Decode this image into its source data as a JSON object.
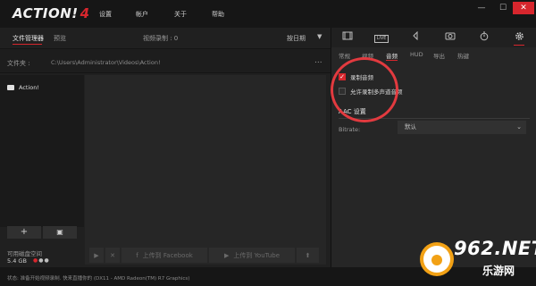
{
  "app": {
    "logo_word": "ACTION!",
    "logo_number": "4",
    "menu": [
      "设置",
      "帐户",
      "关于",
      "帮助"
    ],
    "window_buttons": {
      "minimize": "—",
      "maximize": "☐",
      "close": "✕"
    }
  },
  "file_manager": {
    "tab_file_manager": "文件管理器",
    "tab_preview": "预览",
    "video_count": "视频录制 : 0",
    "sort_label": "按日期",
    "sort_arrow": "▼",
    "folder_label": "文件夹 :",
    "folder_path": "C:\\Users\\Administrator\\Videos\\Action!",
    "folder_more": "...",
    "tree_items": [
      "Action!"
    ],
    "add_button": "+",
    "camera_button": "▣",
    "disk_label": "可用磁盘空间",
    "disk_size": "5.4 GB"
  },
  "actions": {
    "play": "▶",
    "delete": "✕",
    "facebook_icon": "f",
    "upload_facebook": "上传到 Facebook",
    "youtube_icon": "▶",
    "upload_youtube": "上传到 YouTube",
    "extra_icon": "⬆"
  },
  "settings": {
    "top_icons": [
      "film-icon",
      "live-icon",
      "speaker-icon",
      "camera-icon",
      "timer-icon",
      "gear-icon"
    ],
    "live_badge": "LIVE",
    "subtabs": [
      "常规",
      "视频",
      "音频",
      "HUD",
      "导出",
      "热键"
    ],
    "active_subtab": "音频",
    "record_audio_label": "录制音频",
    "record_audio_checked": true,
    "multi_track_label": "允许录制多声道音频",
    "multi_track_checked": false,
    "aac_section_title": "AAC 设置",
    "bitrate_label": "Bitrate:",
    "bitrate_value": "默认",
    "bitrate_arrow": "⌄"
  },
  "status": {
    "text": "状态: 准备开始视频录制. 快来直播你的 (DX11 - AMD Radeon(TM) R7 Graphics)"
  },
  "watermark": {
    "main": "962.NET",
    "sub": "乐游网"
  },
  "colors": {
    "accent": "#d7262d",
    "background": "#1b1b1b",
    "panel": "#262626",
    "annotation": "#e23a3f",
    "watermark_orange": "#f2a115"
  }
}
